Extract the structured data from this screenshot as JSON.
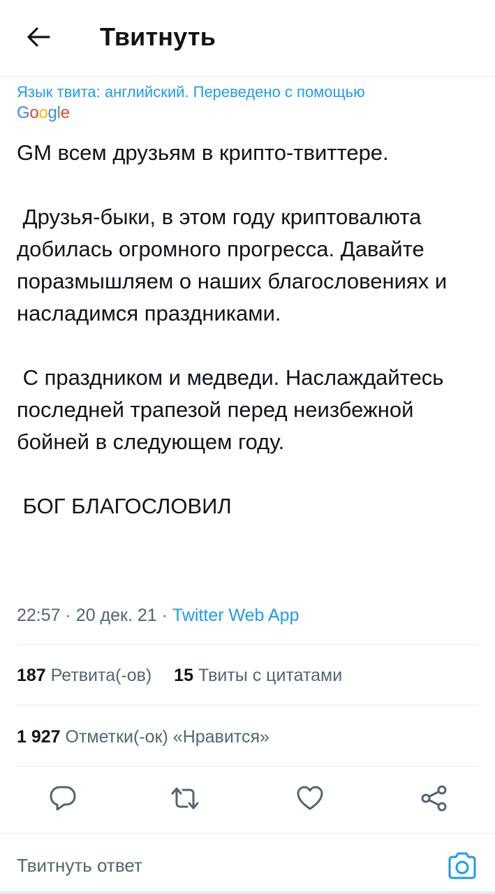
{
  "header": {
    "title": "Твитнуть",
    "back_icon": "arrow-left-icon"
  },
  "translation": {
    "notice": "Язык твита: английский. Переведено с помощью",
    "provider": "Google"
  },
  "tweet": {
    "text": "GM всем друзьям в крипто-твиттере.\n\n Друзья-быки, в этом году криптовалюта добилась огромного прогресса. Давайте поразмышляем о наших благословениях и насладимся праздниками.\n\n С праздником и медведи. Наслаждайтесь последней трапезой перед неизбежной бойней в следующем году.\n\n БОГ БЛАГОСЛОВИЛ",
    "time": "22:57",
    "date": "20 дек. 21",
    "separator": "·",
    "source": "Twitter Web App"
  },
  "stats": {
    "retweets_count": "187",
    "retweets_label": "Ретвита(-ов)",
    "quotes_count": "15",
    "quotes_label": "Твиты с цитатами",
    "likes_count": "1 927",
    "likes_label": "Отметки(-ок) «Нравится»"
  },
  "actions": {
    "reply_icon": "reply-icon",
    "retweet_icon": "retweet-icon",
    "like_icon": "heart-icon",
    "share_icon": "share-icon"
  },
  "reply": {
    "placeholder": "Твитнуть ответ",
    "camera_icon": "camera-icon"
  },
  "colors": {
    "accent": "#1d9bf0",
    "text": "#0f1419",
    "secondary": "#536471",
    "divider": "#e6ecf0"
  }
}
